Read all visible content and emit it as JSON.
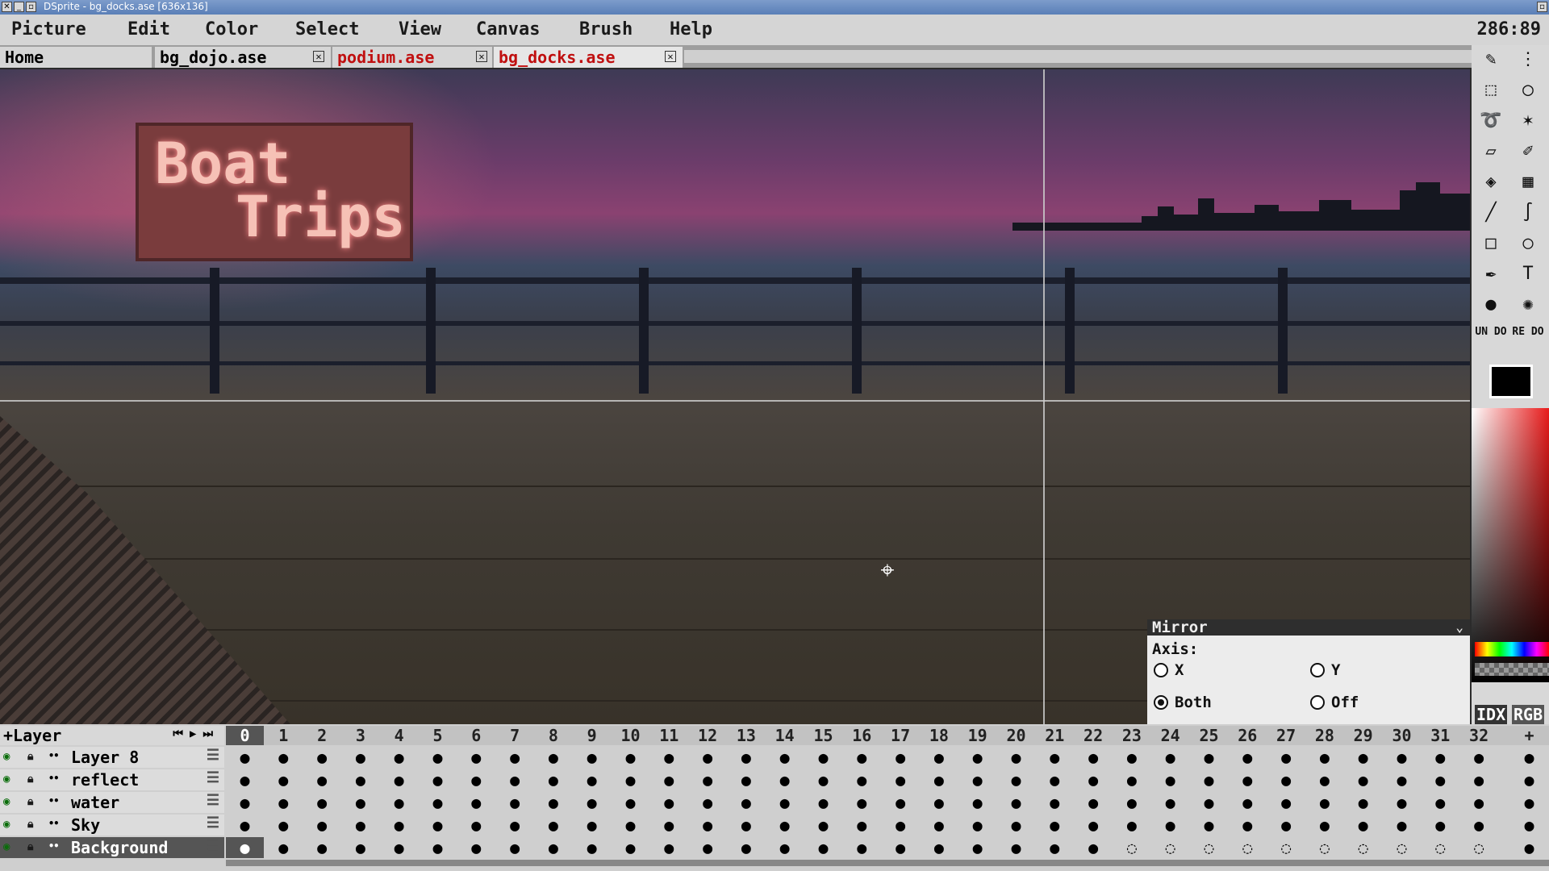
{
  "window": {
    "title": "DSprite - bg_docks.ase [636x136]"
  },
  "menu": {
    "items": [
      "Picture",
      "Edit",
      "Color",
      "Select",
      "View",
      "Canvas",
      "Brush",
      "Help"
    ],
    "coords": "286:89"
  },
  "tabs": [
    {
      "label": "Home",
      "closable": false,
      "color": "#1a1a1a"
    },
    {
      "label": "bg_dojo.ase",
      "closable": true,
      "color": "#1a1a1a"
    },
    {
      "label": "podium.ase",
      "closable": true,
      "color": "#c01010"
    },
    {
      "label": "bg_docks.ase",
      "closable": true,
      "color": "#c01010",
      "active": true
    }
  ],
  "canvas": {
    "sign_line1": "Boat",
    "sign_line2": "Trips"
  },
  "mirror": {
    "title": "Mirror",
    "axis_label": "Axis:",
    "options": [
      {
        "label": "X",
        "selected": false
      },
      {
        "label": "Y",
        "selected": false
      },
      {
        "label": "Both",
        "selected": true
      },
      {
        "label": "Off",
        "selected": false
      }
    ]
  },
  "toolbar": {
    "tools": [
      "pencil-icon",
      "spray-icon",
      "rect-select-icon",
      "ellipse-select-icon",
      "lasso-icon",
      "magic-wand-icon",
      "eraser-icon",
      "eyedropper-icon",
      "fill-icon",
      "gradient-icon",
      "line-icon",
      "curve-icon",
      "rectangle-icon",
      "ellipse-icon",
      "blur-icon",
      "text-icon",
      "dot-brush-icon",
      "pattern-brush-icon"
    ],
    "undo": "UN DO",
    "redo": "RE DO",
    "foreground_color": "#000000",
    "mode_idx": "IDX",
    "mode_rgb": "RGB"
  },
  "timeline": {
    "add_layer": "+Layer",
    "add_frame": "+",
    "frames": [
      "0",
      "1",
      "2",
      "3",
      "4",
      "5",
      "6",
      "7",
      "8",
      "9",
      "10",
      "11",
      "12",
      "13",
      "14",
      "15",
      "16",
      "17",
      "18",
      "19",
      "20",
      "21",
      "22",
      "23",
      "24",
      "25",
      "26",
      "27",
      "28",
      "29",
      "30",
      "31",
      "32"
    ],
    "current_frame": "0",
    "layers": [
      {
        "name": "Layer 8",
        "selected": false,
        "empty_from": null
      },
      {
        "name": "reflect",
        "selected": false,
        "empty_from": null
      },
      {
        "name": "water",
        "selected": false,
        "empty_from": null
      },
      {
        "name": "Sky",
        "selected": false,
        "empty_from": null
      },
      {
        "name": "Background",
        "selected": true,
        "empty_from": 23
      }
    ]
  }
}
